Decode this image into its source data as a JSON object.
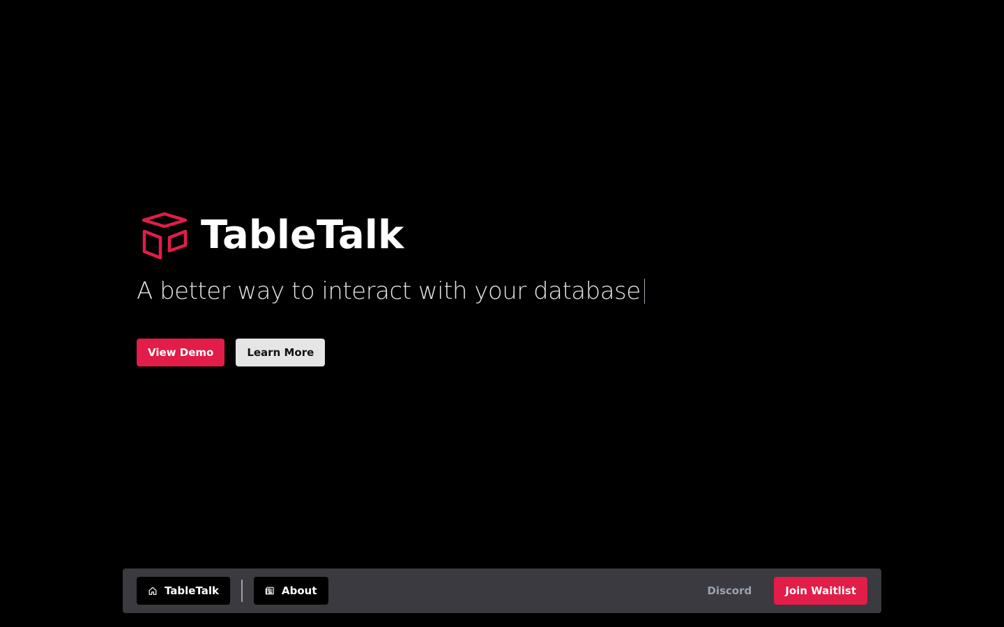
{
  "brand": {
    "name": "TableTalk",
    "logo_icon": "cube-icon",
    "accent_color": "#e11d48"
  },
  "hero": {
    "tagline": "A better way to interact with your database",
    "buttons": {
      "view_demo": "View Demo",
      "learn_more": "Learn More"
    }
  },
  "navbar": {
    "home": {
      "label": "TableTalk",
      "icon": "home-icon"
    },
    "about": {
      "label": "About",
      "icon": "newspaper-icon"
    },
    "discord": "Discord",
    "join_waitlist": "Join Waitlist"
  }
}
